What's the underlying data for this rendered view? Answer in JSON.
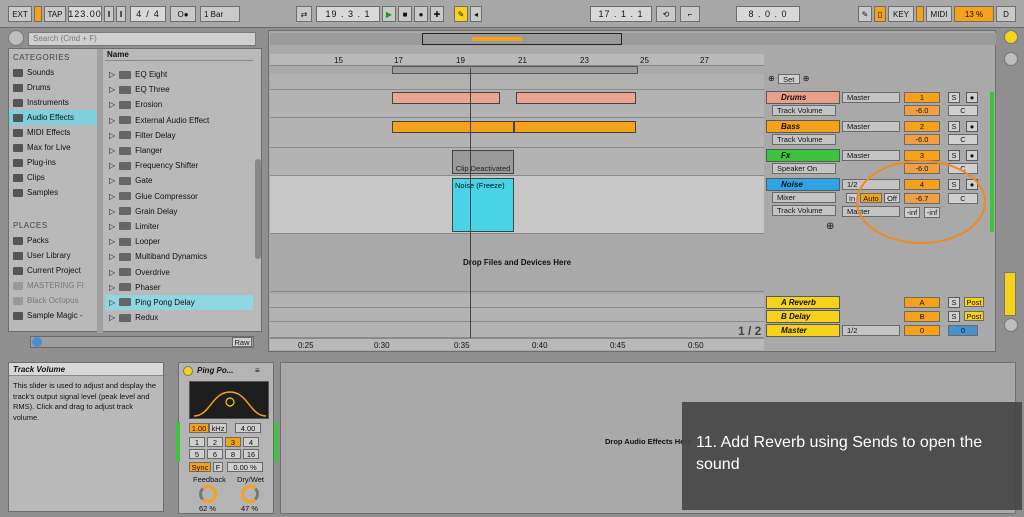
{
  "topbar": {
    "ext": "EXT",
    "tap": "TAP",
    "tempo": "123.00",
    "sig_num": "4",
    "sig_den": "4",
    "metro": "O●",
    "quant": "1 Bar",
    "position": "19 .  3 .  1",
    "loop_start": "17 .  1 .  1",
    "loop_length": "8 .  0 .  0",
    "key": "KEY",
    "midi": "MIDI",
    "cpu": "13 %",
    "d": "D"
  },
  "browser": {
    "search_placeholder": "Search (Cmd + F)",
    "categories_title": "CATEGORIES",
    "categories": [
      "Sounds",
      "Drums",
      "Instruments",
      "Audio Effects",
      "MIDI Effects",
      "Max for Live",
      "Plug-ins",
      "Clips",
      "Samples"
    ],
    "places_title": "PLACES",
    "places": [
      "Packs",
      "User Library",
      "Current Project",
      "MASTERING FI",
      "Black Octopus",
      "Sample Magic -"
    ],
    "name_header": "Name",
    "items": [
      "EQ Eight",
      "EQ Three",
      "Erosion",
      "External Audio Effect",
      "Filter Delay",
      "Flanger",
      "Frequency Shifter",
      "Gate",
      "Glue Compressor",
      "Grain Delay",
      "Limiter",
      "Looper",
      "Multiband Dynamics",
      "Overdrive",
      "Phaser",
      "Ping Pong Delay",
      "Redux"
    ],
    "raw": "Raw"
  },
  "arrangement": {
    "ruler": [
      "15",
      "17",
      "19",
      "21",
      "23",
      "25",
      "27"
    ],
    "time_ruler": [
      "0:25",
      "0:30",
      "0:35",
      "0:40",
      "0:45",
      "0:50"
    ],
    "set_label": "Set",
    "drop_text": "Drop Files and Devices Here",
    "clip_deactivated": "Clip Deactivated",
    "noise_clip": "Noise (Freeze)",
    "page": "1 / 2"
  },
  "tracks": [
    {
      "name": "Drums",
      "color": "#e8a08a",
      "chooser": "Track Volume",
      "routing": "Master",
      "num": "1",
      "vol": "-6.0",
      "pan": "C"
    },
    {
      "name": "Bass",
      "color": "#f6a11a",
      "chooser": "Track Volume",
      "routing": "Master",
      "num": "2",
      "vol": "-6.0",
      "pan": "C"
    },
    {
      "name": "Fx",
      "color": "#3cc43c",
      "chooser": "Speaker On",
      "routing": "Master",
      "num": "3",
      "vol": "-6.0",
      "pan": "C"
    },
    {
      "name": "Noise",
      "color": "#2ea3e6",
      "chooser": "Mixer",
      "chooser2": "Track Volume",
      "routing": "Master",
      "num": "4",
      "vol": "-6.7",
      "pan": "C",
      "in": "In",
      "auto": "Auto",
      "off": "Off",
      "send_a": "-inf",
      "send_b": "-inf",
      "input": "1/2"
    }
  ],
  "returns": [
    {
      "name": "A Reverb",
      "num": "A",
      "s": "S",
      "post": "Post"
    },
    {
      "name": "B Delay",
      "num": "B",
      "s": "S",
      "post": "Post"
    },
    {
      "name": "Master",
      "num": "0",
      "routing": "1/2",
      "vol": "0"
    }
  ],
  "info": {
    "title": "Track Volume",
    "body": "This slider is used to adjust and display the track's output signal level (peak level and RMS). Click and drag to adjust track volume."
  },
  "device": {
    "name": "Ping Po...",
    "freq": "1.00",
    "freq_unit": "kHz",
    "q": "4.00",
    "grid": [
      "1",
      "2",
      "3",
      "4",
      "5",
      "6",
      "8",
      "16"
    ],
    "sync": "Sync",
    "f": "F",
    "pct": "0.00 %",
    "feedback_label": "Feedback",
    "feedback": "62 %",
    "drywet_label": "Dry/Wet",
    "drywet": "47 %"
  },
  "drop_fx": "Drop Audio Effects Here",
  "caption": "11. Add Reverb using Sends to open the sound",
  "colors": {
    "accent": "#f6a11a",
    "highlight": "#f08a1a",
    "selection": "#7fd0dc"
  }
}
